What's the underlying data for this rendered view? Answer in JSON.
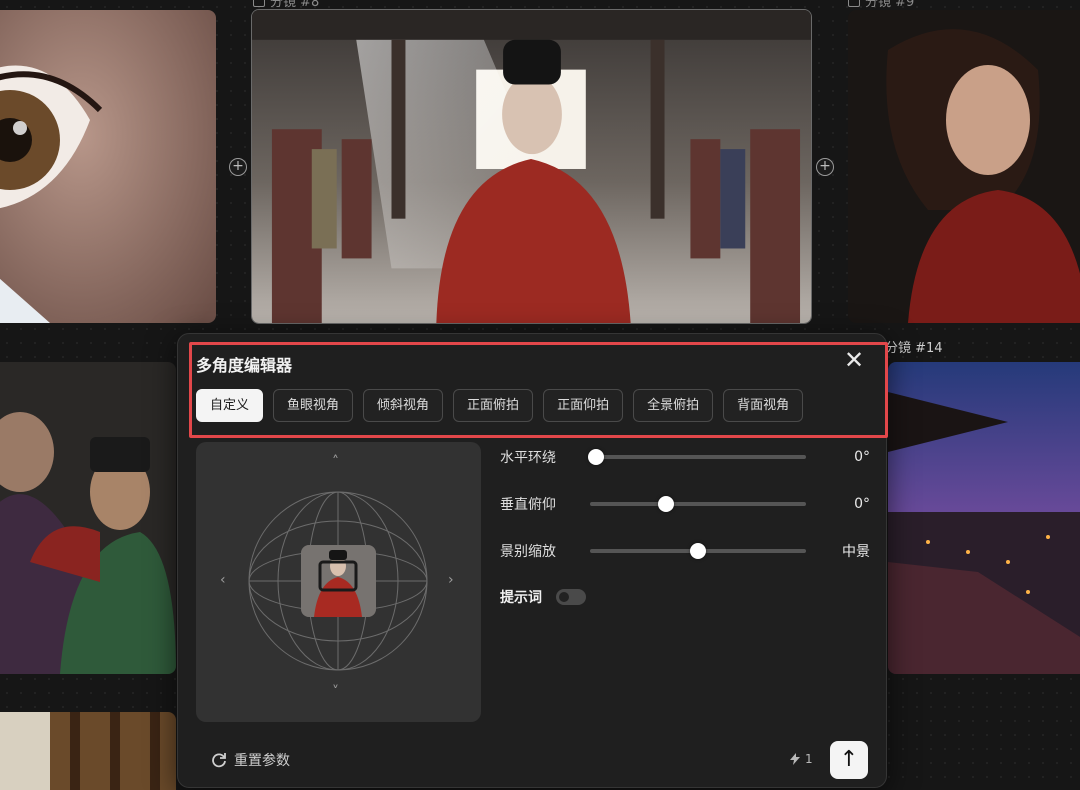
{
  "background": {
    "frame_labels": [
      "分镜 #8",
      "分镜 #9",
      "分镜 #14"
    ],
    "add_button_symbol": "+"
  },
  "editor": {
    "title": "多角度编辑器",
    "close_symbol": "✕",
    "presets": [
      "自定义",
      "鱼眼视角",
      "倾斜视角",
      "正面俯拍",
      "正面仰拍",
      "全景俯拍",
      "背面视角"
    ],
    "active_preset": "自定义",
    "preview_arrows": {
      "up": "˄",
      "down": "˅",
      "left": "‹",
      "right": "›"
    },
    "sliders": [
      {
        "label": "水平环绕",
        "value": "0°",
        "fraction": 0.03
      },
      {
        "label": "垂直俯仰",
        "value": "0°",
        "fraction": 0.35
      },
      {
        "label": "景别缩放",
        "value": "中景",
        "fraction": 0.5
      }
    ],
    "prompt_toggle": {
      "label": "提示词",
      "on": false
    },
    "reset_label": "重置参数",
    "credits": "1",
    "send_symbol": "↑"
  },
  "colors": {
    "highlight": "#e2474a",
    "panel": "#1f1f1f",
    "active_preset": "#f4f4f4"
  },
  "icons": [
    "plus-circle-icon",
    "close-icon",
    "globe-icon",
    "refresh-icon",
    "lightning-icon",
    "arrow-up-icon"
  ]
}
